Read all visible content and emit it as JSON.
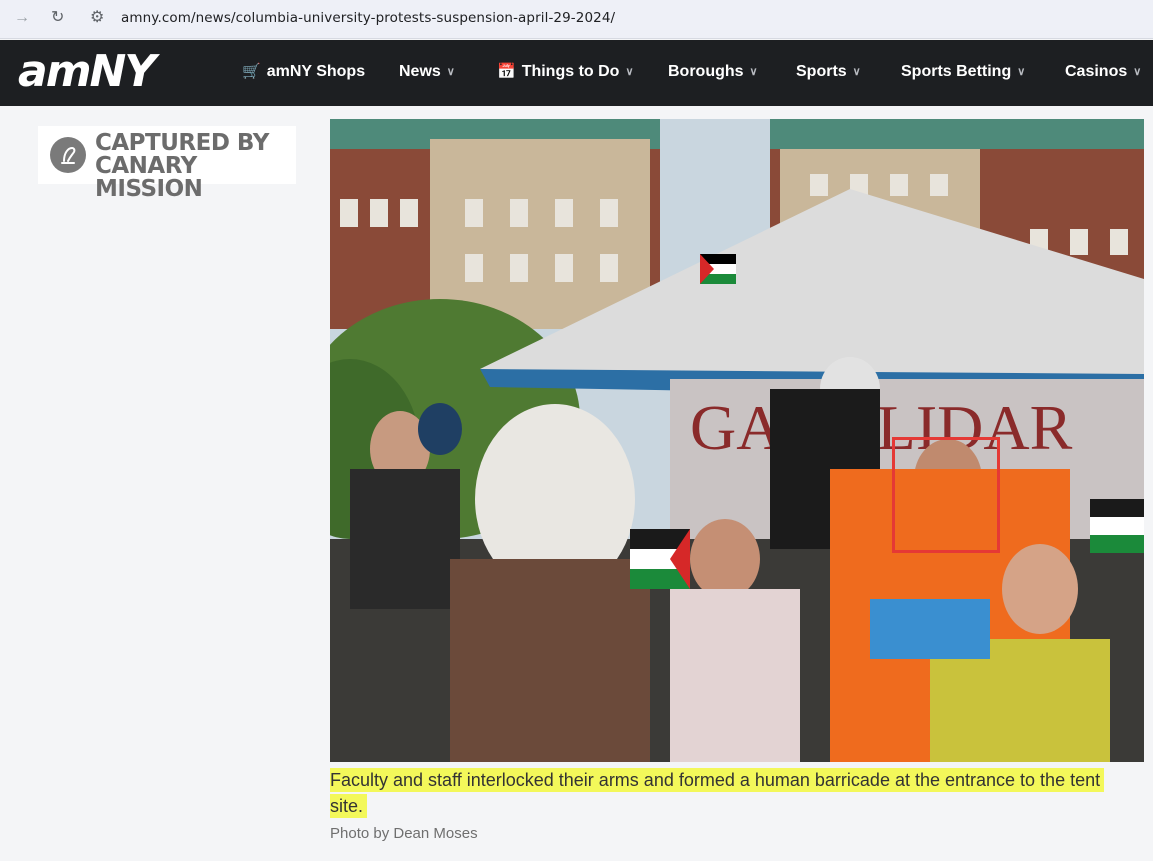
{
  "browser": {
    "url": "amny.com/news/columbia-university-protests-suspension-april-29-2024/"
  },
  "site": {
    "logo_text": "amNY",
    "nav": [
      {
        "label": "amNY Shops",
        "icon": "cart-icon",
        "dropdown": false
      },
      {
        "label": "News",
        "dropdown": true
      },
      {
        "label": "Things to Do",
        "icon": "calendar-icon",
        "dropdown": true
      },
      {
        "label": "Boroughs",
        "dropdown": true
      },
      {
        "label": "Sports",
        "dropdown": true
      },
      {
        "label": "Sports Betting",
        "dropdown": true
      },
      {
        "label": "Casinos",
        "dropdown": true
      }
    ],
    "accent_color": "#e53935"
  },
  "watermark": {
    "line1": "CAPTURED BY",
    "line2": "CANARY MISSION"
  },
  "article": {
    "caption": "Faculty and staff interlocked their arms and formed a human barricade at the entrance to the tent site.",
    "credit": "Photo by Dean Moses",
    "highlight_color": "#f3f85a"
  }
}
